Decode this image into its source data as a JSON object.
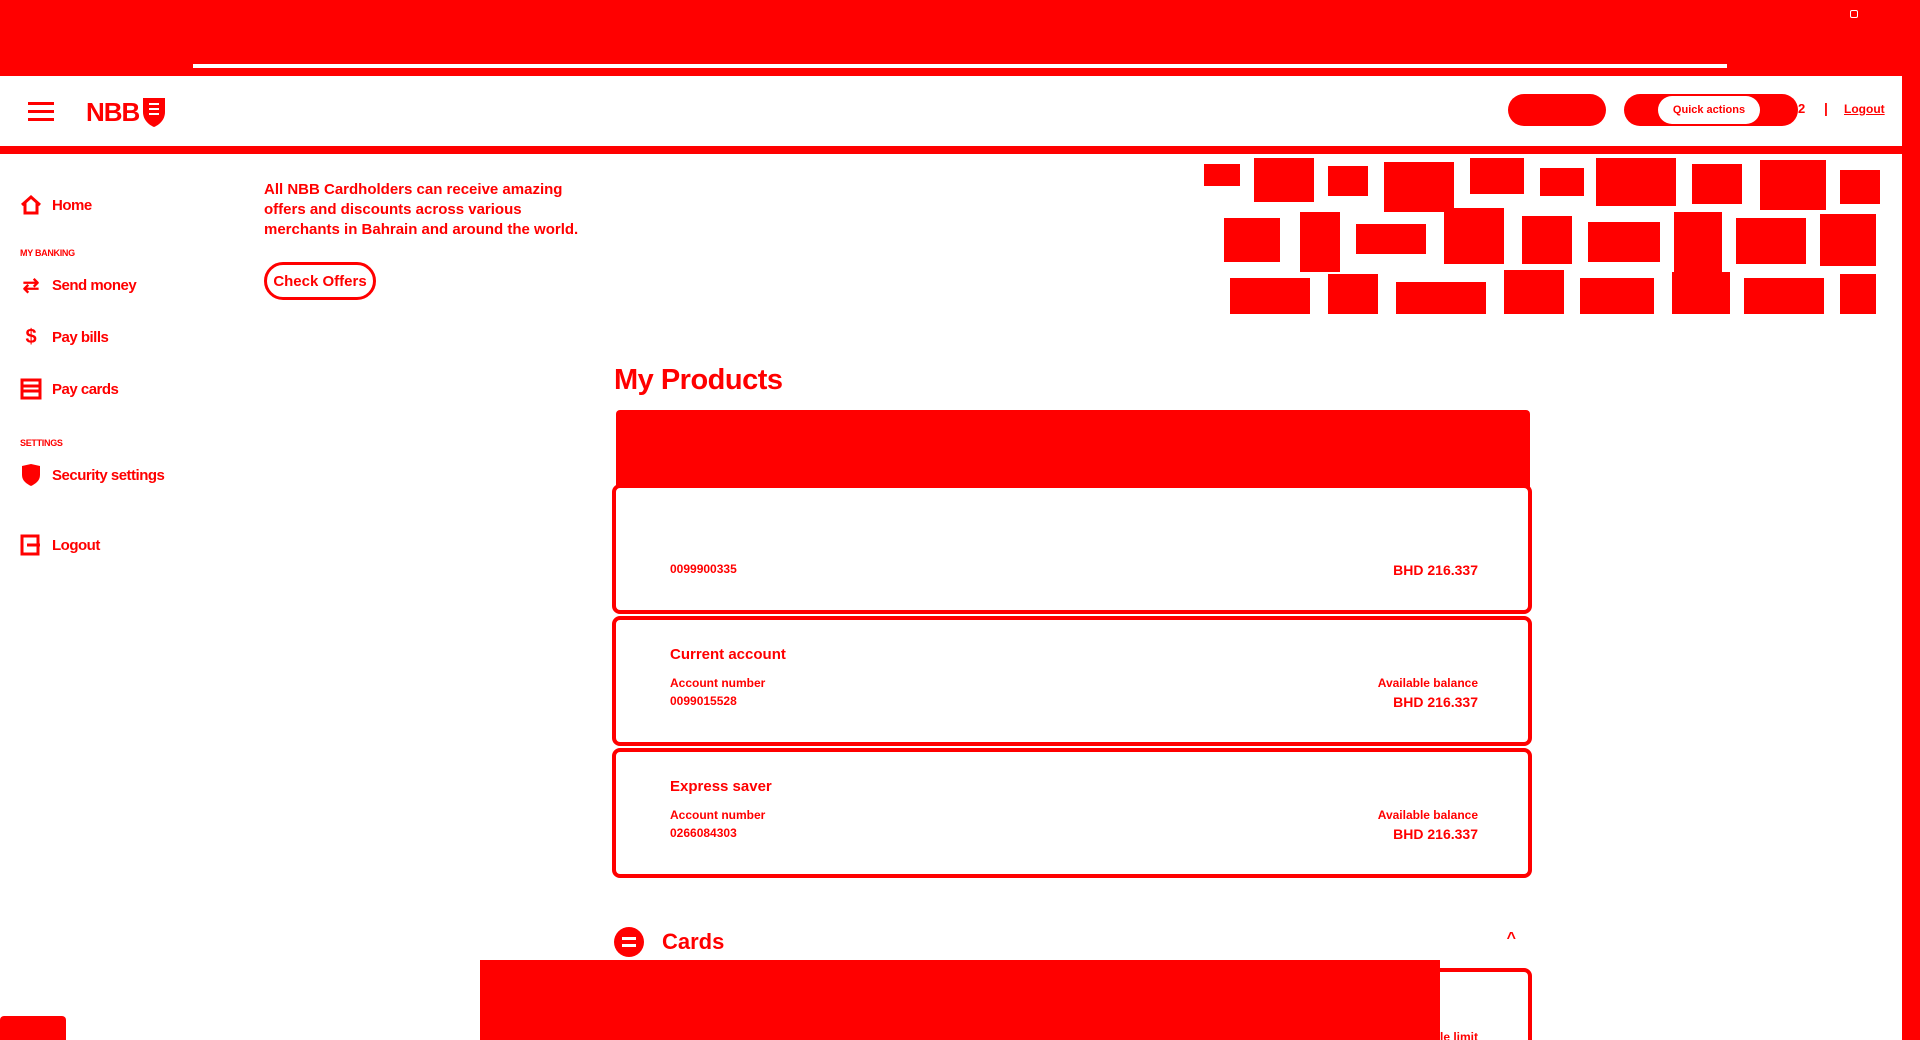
{
  "header": {
    "brand": "NBB",
    "quick_actions_label": "Quick actions",
    "user_suffix": "2",
    "separator": "|",
    "logout_label": "Logout"
  },
  "sidebar": {
    "items": [
      {
        "label": "Home",
        "icon": "home-icon"
      },
      {
        "label": "Send money",
        "icon": "transfer-icon"
      },
      {
        "label": "Pay bills",
        "icon": "bill-icon"
      },
      {
        "label": "Pay cards",
        "icon": "card-icon"
      },
      {
        "label": "Security settings",
        "icon": "shield-icon"
      },
      {
        "label": "Logout",
        "icon": "logout-icon"
      }
    ],
    "sections": {
      "banking": "MY BANKING",
      "settings": "SETTINGS"
    }
  },
  "promo": {
    "text": "All NBB Cardholders can receive amazing offers and discounts across various merchants in Bahrain and around the world.",
    "button_label": "Check Offers"
  },
  "products": {
    "title": "My Products",
    "accounts": [
      {
        "name": "",
        "number_label": "",
        "number": "0099900335",
        "balance_label": "",
        "balance": "BHD 216.337"
      },
      {
        "name": "Current account",
        "number_label": "Account number",
        "number": "0099015528",
        "balance_label": "Available balance",
        "balance": "BHD 216.337"
      },
      {
        "name": "Express saver",
        "number_label": "Account number",
        "number": "0266084303",
        "balance_label": "Available balance",
        "balance": "BHD 216.337"
      }
    ],
    "cards_label": "Cards",
    "cards_limit_label": "le limit"
  },
  "colors": {
    "brand": "#ff0000",
    "surface": "#ffffff"
  }
}
